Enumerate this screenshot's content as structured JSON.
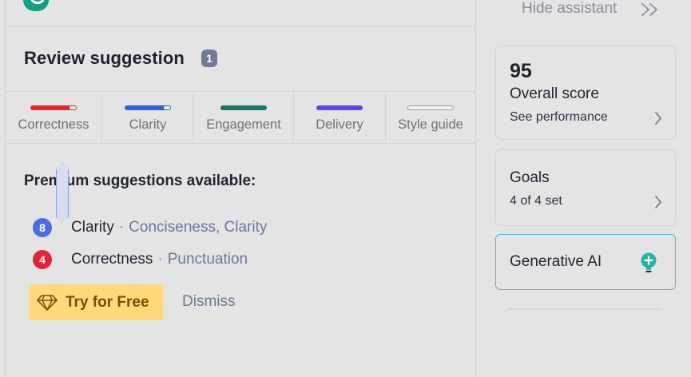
{
  "header": {
    "hide_assistant_label": "Hide assistant"
  },
  "review": {
    "title": "Review suggestion",
    "count": "1"
  },
  "tabs": [
    {
      "label": "Correctness",
      "color": "#e5262c",
      "state": "partial"
    },
    {
      "label": "Clarity",
      "color": "#2d5fde",
      "state": "partial"
    },
    {
      "label": "Engagement",
      "color": "#17776a",
      "state": "full"
    },
    {
      "label": "Delivery",
      "color": "#6544e6",
      "state": "full"
    },
    {
      "label": "Style guide",
      "color": "#9a9a9a",
      "state": "empty"
    }
  ],
  "premium": {
    "title": "Premium suggestions available:",
    "items": [
      {
        "count": "8",
        "category": "Clarity",
        "separator": "·",
        "details": "Conciseness, Clarity",
        "badge_color": "#4a6ee8"
      },
      {
        "count": "4",
        "category": "Correctness",
        "separator": "·",
        "details": "Punctuation",
        "badge_color": "#e0253a"
      }
    ],
    "try_label": "Try for Free",
    "dismiss_label": "Dismiss"
  },
  "sidebar": {
    "score": {
      "value": "95",
      "label": "Overall score",
      "link": "See performance"
    },
    "goals": {
      "label": "Goals",
      "sub": "4 of 4 set"
    },
    "genai": {
      "label": "Generative AI",
      "icon_color": "#1fb6a6"
    }
  },
  "icons": {
    "logo": "grammarly-logo",
    "hide": "double-chevron-right-icon",
    "diamond": "diamond-icon",
    "chevron": "chevron-right-icon",
    "genai": "lightbulb-plus-icon"
  }
}
